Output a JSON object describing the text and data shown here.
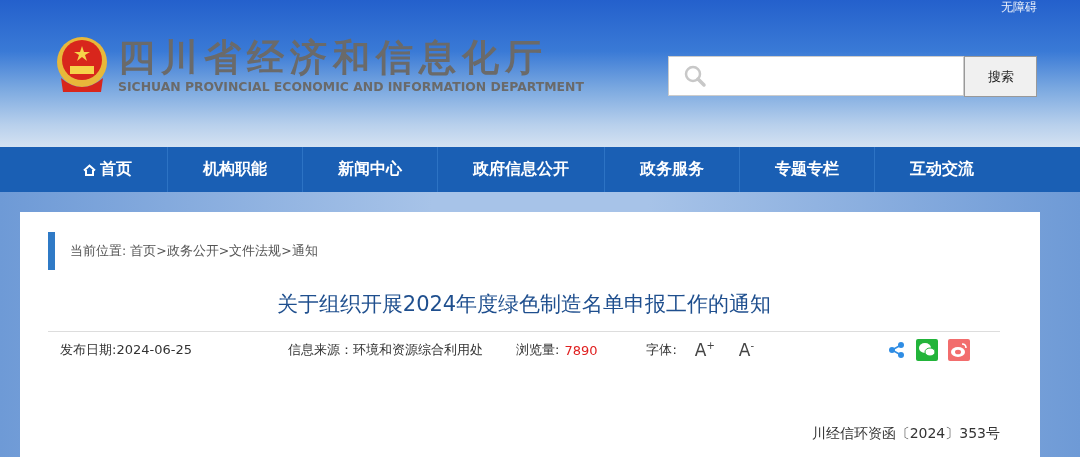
{
  "accessibility_link": "无障碍",
  "site": {
    "title_cn": "四川省经济和信息化厅",
    "title_en": "SICHUAN PROVINCIAL ECONOMIC AND INFORMATION DEPARTMENT"
  },
  "search": {
    "button": "搜索"
  },
  "nav": [
    {
      "label": "首页",
      "kind": "home"
    },
    {
      "label": "机构职能",
      "kind": "plain"
    },
    {
      "label": "新闻中心",
      "kind": "plain"
    },
    {
      "label": "政府信息公开",
      "kind": "plain"
    },
    {
      "label": "政务服务",
      "kind": "plain"
    },
    {
      "label": "专题专栏",
      "kind": "plain"
    },
    {
      "label": "互动交流",
      "kind": "plain"
    }
  ],
  "breadcrumb": "当前位置: 首页>政务公开>文件法规>通知",
  "article": {
    "title": "关于组织开展2024年度绿色制造名单申报工作的通知",
    "date": "发布日期:2024-06-25",
    "source": "信息来源：环境和资源综合利用处",
    "views_label": "浏览量:",
    "views": "7890",
    "font_label": "字体:",
    "font_larger": "A$^{+}$",
    "font_smaller": "A$^{-}$",
    "doc_number": "川经信环资函〔2024〕353号"
  }
}
